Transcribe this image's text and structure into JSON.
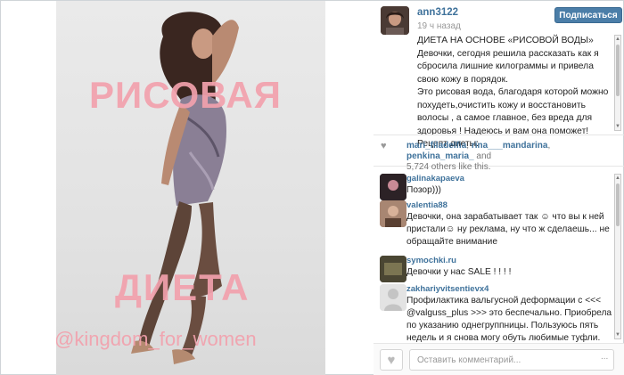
{
  "photo": {
    "overlay_title": "РИСОВАЯ",
    "overlay_subtitle": "ДИЕТА",
    "overlay_handle": "@kingdom_for_women"
  },
  "post": {
    "username": "ann3122",
    "time_ago": "19 ч назад",
    "follow_label": "Подписаться",
    "caption_lines": [
      "ДИЕТА НА ОСНОВЕ «РИСОВОЙ ВОДЫ»",
      "Девочки, сегодня решила рассказать как я сбросила лишние килограммы и привела свою кожу в порядок. ",
      "Это рисовая вода, благодаря которой можно похудеть,очистить кожу и восстановить волосы , а самое главное, без вреда для здоровья ! Надеюсь и вам она поможет! ",
      "Рецепт диеты:"
    ]
  },
  "likes": {
    "user1": "mari_filadelfia",
    "user2": "rina___mandarina",
    "user3": "penkina_maria_",
    "and_text": "and",
    "others": "5,724 others like this."
  },
  "comments": [
    {
      "user": "galinakapaeva",
      "text": "Позор)))"
    },
    {
      "user": "valentia88",
      "text": "Девочки, она зарабатывает так ☺ что вы к ней пристали☺ ну реклама, ну что ж сделаешь... не обращайте внимание"
    },
    {
      "user": "symochki.ru",
      "text": "Девочки у нас SALE ! ! ! !"
    },
    {
      "user": "zakhariyvitsentievx4",
      "text": "Профилактика вальгусной деформации с <<< @valguss_plus >>> это беспечально. Приобрела по указанию однегруппницы. Пользуюсь пять недель и я снова могу обуть любимые туфли. Результатом"
    }
  ],
  "footer": {
    "comment_placeholder": "Оставить комментарий...",
    "more_label": "..."
  },
  "colors": {
    "link": "#3f729b",
    "follow_button": "#4b7ea8",
    "overlay_text": "#f2a1ad"
  }
}
